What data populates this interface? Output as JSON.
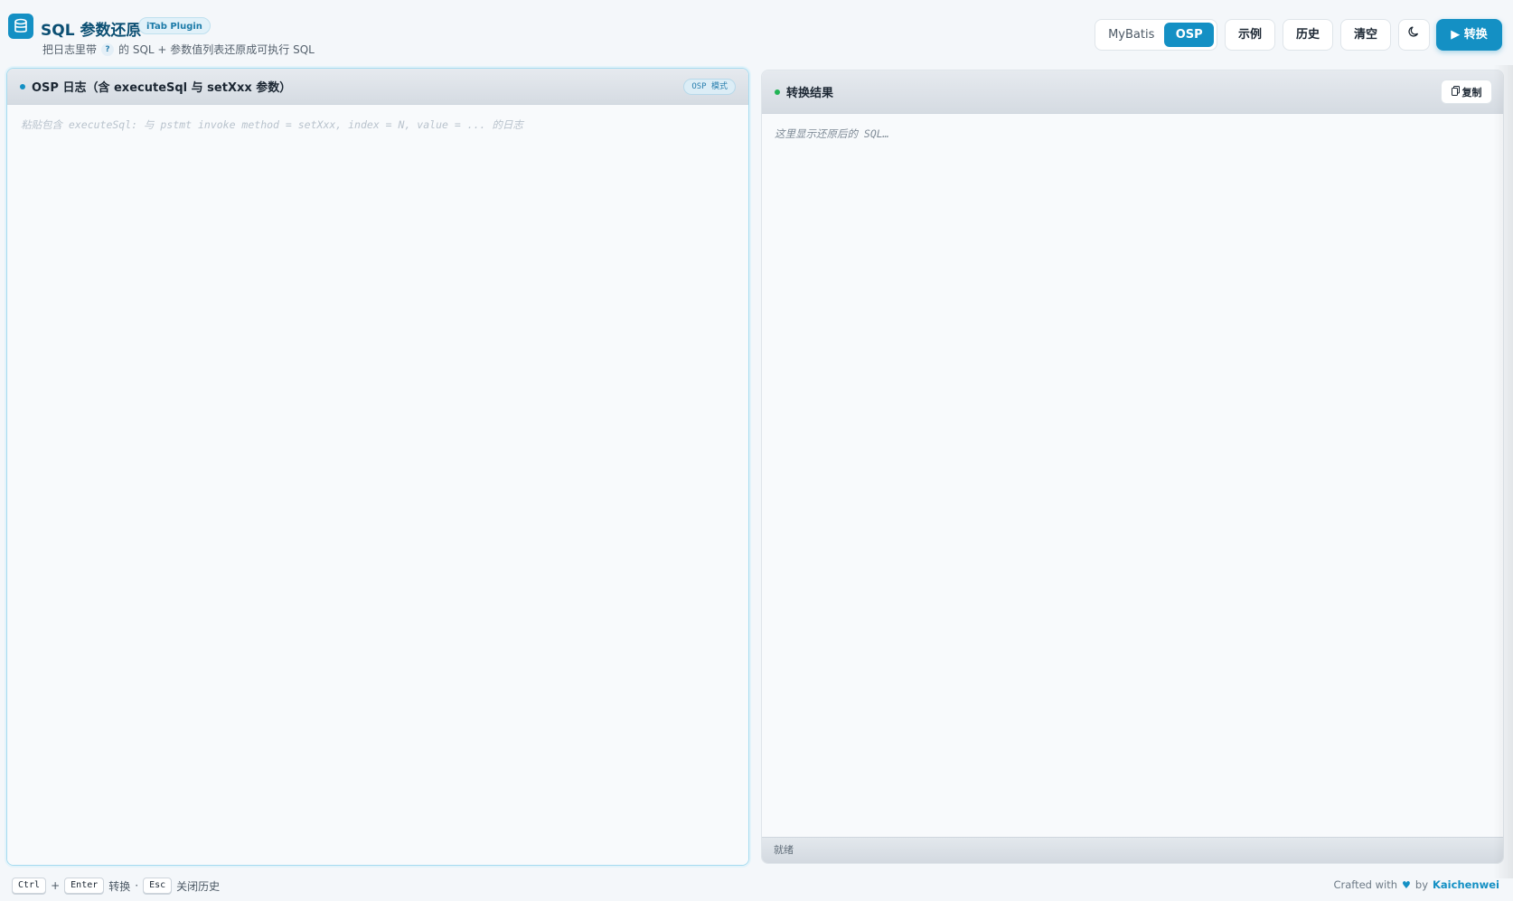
{
  "header": {
    "title": "SQL 参数还原",
    "badge": "iTab Plugin",
    "subtitle_before": "把日志里带",
    "subtitle_mark": "?",
    "subtitle_after": "的 SQL + 参数值列表还原成可执行 SQL",
    "mode_options": [
      "MyBatis",
      "OSP"
    ],
    "mode_selected": "OSP",
    "example_label": "示例",
    "history_label": "历史",
    "clear_label": "清空",
    "theme_icon": "moon-icon",
    "run_label": "转换",
    "run_icon": "play-icon"
  },
  "left_panel": {
    "title": "OSP 日志（含 executeSql 与 setXxx 参数）",
    "mode_tag": "OSP 模式",
    "dot_color": "#1490c4",
    "placeholder": "粘贴包含 executeSql: 与 pstmt invoke method = setXxx, index = N, value = ... 的日志",
    "value": ""
  },
  "right_panel": {
    "title": "转换结果",
    "dot_color": "#22b455",
    "copy_label": "复制",
    "copy_icon": "copy-icon",
    "placeholder": "这里显示还原后的 SQL…",
    "status": "就绪"
  },
  "footer": {
    "keys": [
      "Ctrl",
      "+",
      "Enter",
      "转换",
      "·",
      "Esc",
      "关闭历史"
    ],
    "crafted": "Crafted with",
    "by": "by",
    "author": "Kaichenwei"
  },
  "colors": {
    "accent": "#1490c4",
    "title": "#0b4f73",
    "ok": "#22b455"
  }
}
